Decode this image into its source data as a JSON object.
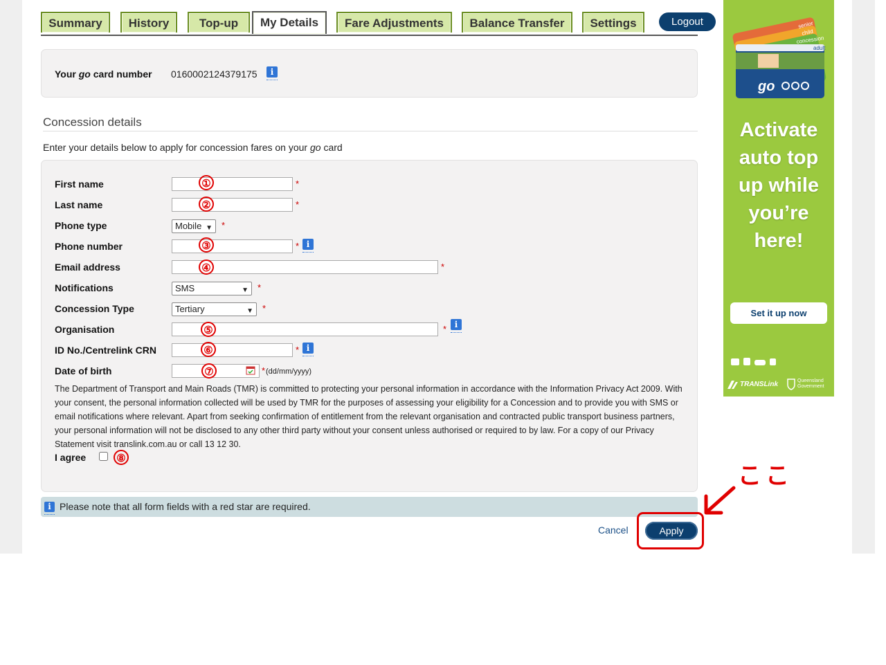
{
  "tabs": [
    {
      "label": "Summary"
    },
    {
      "label": "History"
    },
    {
      "label": "Top-up"
    },
    {
      "label": "My Details"
    },
    {
      "label": "Fare Adjustments"
    },
    {
      "label": "Balance Transfer"
    },
    {
      "label": "Settings"
    }
  ],
  "logout_label": "Logout",
  "card": {
    "label_prefix": "Your ",
    "label_go": "go",
    "label_suffix": " card number",
    "number": "0160002124379175"
  },
  "section_title": "Concession details",
  "intro": {
    "before": "Enter your details below to apply for concession fares on your ",
    "go": "go",
    "after": " card"
  },
  "form": {
    "first_name_label": "First name",
    "last_name_label": "Last name",
    "phone_type_label": "Phone type",
    "phone_type_value": "Mobile",
    "phone_number_label": "Phone number",
    "email_label": "Email address",
    "notifications_label": "Notifications",
    "notifications_value": "SMS",
    "concession_type_label": "Concession Type",
    "concession_type_value": "Tertiary",
    "organisation_label": "Organisation",
    "id_label": "ID No./Centrelink CRN",
    "dob_label": "Date of birth",
    "dob_hint": "(dd/mm/yyyy)",
    "required_star": "*",
    "agree_label": "I agree"
  },
  "privacy_text": "The Department of Transport and Main Roads (TMR) is committed to protecting your personal information in accordance with the Information Privacy Act 2009. With your consent, the personal information collected will be used by TMR for the purposes of assessing your eligibility for a Concession and to provide you with SMS or email notifications where relevant. Apart from seeking confirmation of entitlement from the relevant organisation and contracted public transport business partners, your personal information will not be disclosed to any other third party without your consent unless authorised or required to by law. For a copy of our Privacy Statement visit translink.com.au or call 13 12 30.",
  "note_text": "Please note that all form fields with a red star are required.",
  "cancel_label": "Cancel",
  "apply_label": "Apply",
  "annotations": {
    "markers": [
      "①",
      "②",
      "③",
      "④",
      "⑤",
      "⑥",
      "⑦",
      "⑧"
    ],
    "callout_text": "ここ",
    "color": "#e00000"
  },
  "ad": {
    "headline": "Activate auto top up while you’re here!",
    "button": "Set it up now",
    "brand": "TRANSLink",
    "gov": "Queensland Government",
    "card_labels": [
      "senior",
      "child",
      "concession",
      "adult"
    ],
    "card_logo": "go"
  },
  "info_glyph": "i"
}
